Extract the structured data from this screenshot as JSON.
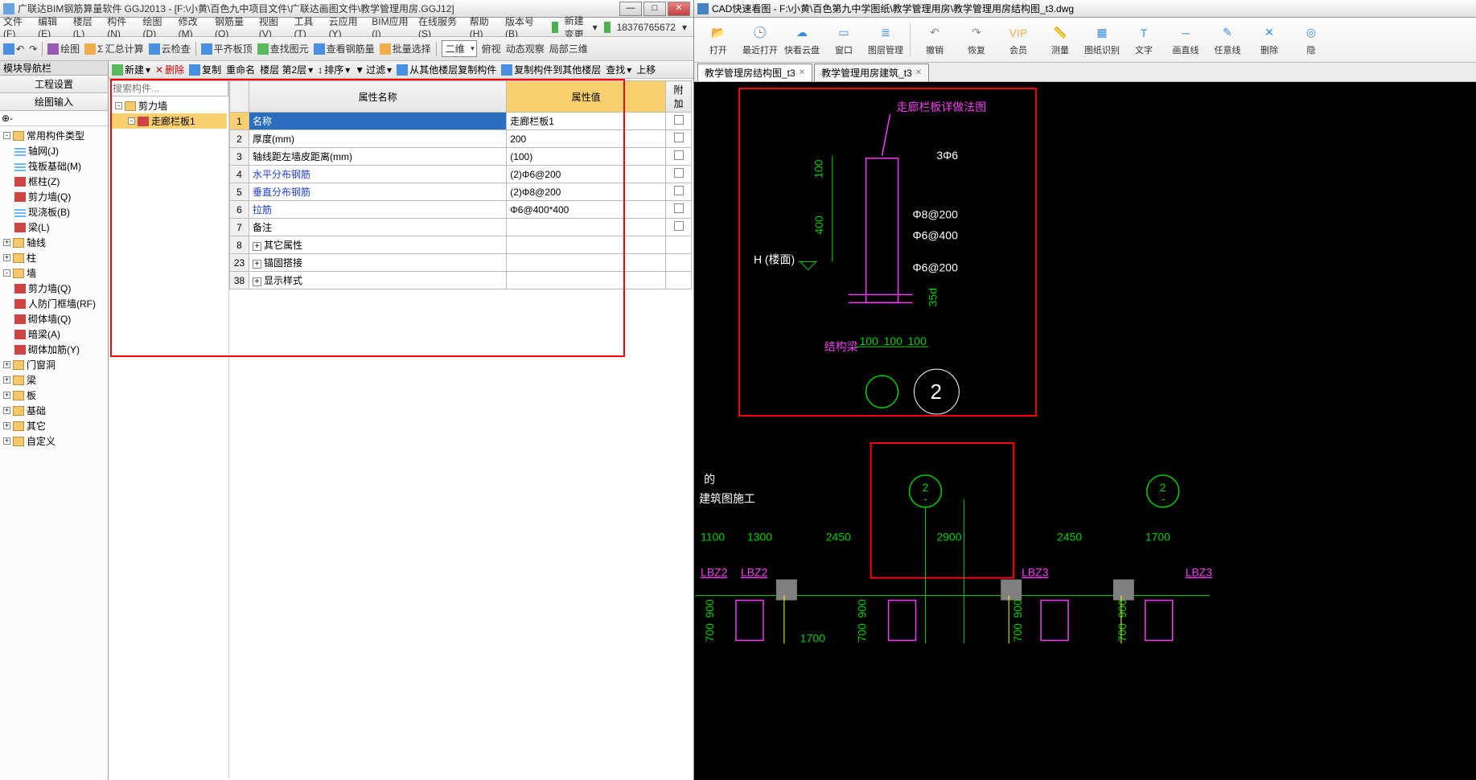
{
  "left": {
    "title": "广联达BIM钢筋算量软件 GGJ2013 - [F:\\小黄\\百色九中项目文件\\广联达画图文件\\教学管理用房.GGJ12]",
    "menu": [
      "文件(F)",
      "编辑(E)",
      "楼层(L)",
      "构件(N)",
      "绘图(D)",
      "修改(M)",
      "钢筋量(Q)",
      "视图(V)",
      "工具(T)",
      "云应用(Y)",
      "BIM应用(I)",
      "在线服务(S)",
      "帮助(H)",
      "版本号(B)"
    ],
    "menu_right": {
      "new_change": "新建变更",
      "phone": "18376765672"
    },
    "toolbar1": [
      "绘图",
      "汇总计算",
      "云检查",
      "平齐板顶",
      "查找图元",
      "查看钢筋量",
      "批量选择"
    ],
    "toolbar1_right": {
      "mode": "二维",
      "items": [
        "俯视",
        "动态观察",
        "局部三维"
      ]
    },
    "nav": {
      "title": "模块导航栏",
      "tabs": [
        "工程设置",
        "绘图输入"
      ]
    },
    "tree": [
      {
        "lvl": 0,
        "exp": "-",
        "ico": "folder",
        "label": "常用构件类型"
      },
      {
        "lvl": 1,
        "ico": "grid",
        "label": "轴网(J)"
      },
      {
        "lvl": 1,
        "ico": "grid",
        "label": "筏板基础(M)"
      },
      {
        "lvl": 1,
        "ico": "bar",
        "label": "框柱(Z)"
      },
      {
        "lvl": 1,
        "ico": "bar",
        "label": "剪力墙(Q)"
      },
      {
        "lvl": 1,
        "ico": "grid",
        "label": "现浇板(B)"
      },
      {
        "lvl": 1,
        "ico": "bar",
        "label": "梁(L)"
      },
      {
        "lvl": 0,
        "exp": "+",
        "ico": "folder",
        "label": "轴线"
      },
      {
        "lvl": 0,
        "exp": "+",
        "ico": "folder",
        "label": "柱"
      },
      {
        "lvl": 0,
        "exp": "-",
        "ico": "folder",
        "label": "墙"
      },
      {
        "lvl": 1,
        "ico": "bar",
        "label": "剪力墙(Q)"
      },
      {
        "lvl": 1,
        "ico": "bar",
        "label": "人防门框墙(RF)"
      },
      {
        "lvl": 1,
        "ico": "bar",
        "label": "砌体墙(Q)"
      },
      {
        "lvl": 1,
        "ico": "bar",
        "label": "暗梁(A)"
      },
      {
        "lvl": 1,
        "ico": "bar",
        "label": "砌体加筋(Y)"
      },
      {
        "lvl": 0,
        "exp": "+",
        "ico": "folder",
        "label": "门窗洞"
      },
      {
        "lvl": 0,
        "exp": "+",
        "ico": "folder",
        "label": "梁"
      },
      {
        "lvl": 0,
        "exp": "+",
        "ico": "folder",
        "label": "板"
      },
      {
        "lvl": 0,
        "exp": "+",
        "ico": "folder",
        "label": "基础"
      },
      {
        "lvl": 0,
        "exp": "+",
        "ico": "folder",
        "label": "其它"
      },
      {
        "lvl": 0,
        "exp": "+",
        "ico": "folder",
        "label": "自定义"
      }
    ],
    "center_tb": [
      "新建",
      "删除",
      "复制",
      "重命名",
      "楼层 第2层",
      "排序",
      "过滤",
      "从其他楼层复制构件",
      "复制构件到其他楼层",
      "查找",
      "上移"
    ],
    "comp_search_placeholder": "搜索构件...",
    "comp_tree": [
      {
        "label": "剪力墙",
        "sel": false,
        "lvl": 0
      },
      {
        "label": "走廊栏板1",
        "sel": true,
        "lvl": 1
      }
    ],
    "prop_headers": {
      "num": "",
      "name": "属性名称",
      "value": "属性值",
      "extra": "附加"
    },
    "prop_rows": [
      {
        "n": "1",
        "name": "名称",
        "value": "走廊栏板1",
        "sel": true
      },
      {
        "n": "2",
        "name": "厚度(mm)",
        "value": "200"
      },
      {
        "n": "3",
        "name": "轴线距左墙皮距离(mm)",
        "value": "(100)"
      },
      {
        "n": "4",
        "name": "水平分布钢筋",
        "value": "(2)Φ6@200",
        "link": true
      },
      {
        "n": "5",
        "name": "垂直分布钢筋",
        "value": "(2)Φ8@200",
        "link": true
      },
      {
        "n": "6",
        "name": "拉筋",
        "value": "Φ6@400*400",
        "link": true
      },
      {
        "n": "7",
        "name": "备注",
        "value": ""
      },
      {
        "n": "8",
        "name": "其它属性",
        "value": "",
        "grp": true
      },
      {
        "n": "23",
        "name": "锚固搭接",
        "value": "",
        "grp": true
      },
      {
        "n": "38",
        "name": "显示样式",
        "value": "",
        "grp": true
      }
    ]
  },
  "right": {
    "title": "CAD快速看图 - F:\\小黄\\百色第九中学图纸\\教学管理用房\\教学管理用房结构图_t3.dwg",
    "ribbon": [
      {
        "icon": "📂",
        "color": "blue",
        "label": "打开"
      },
      {
        "icon": "🕒",
        "color": "blue",
        "label": "最近打开"
      },
      {
        "icon": "☁",
        "color": "blue",
        "label": "快看云盘"
      },
      {
        "icon": "▭",
        "color": "blue",
        "label": "窗口"
      },
      {
        "icon": "≣",
        "color": "blue",
        "label": "图层管理"
      },
      {
        "sep": true
      },
      {
        "icon": "↶",
        "color": "gray",
        "label": "撤销"
      },
      {
        "icon": "↷",
        "color": "gray",
        "label": "恢复"
      },
      {
        "icon": "VIP",
        "color": "orange",
        "label": "会员"
      },
      {
        "icon": "📏",
        "color": "blue",
        "label": "测量"
      },
      {
        "icon": "▦",
        "color": "blue",
        "label": "图纸识别"
      },
      {
        "icon": "T",
        "color": "blue",
        "label": "文字"
      },
      {
        "icon": "─",
        "color": "blue",
        "label": "画直线"
      },
      {
        "icon": "✎",
        "color": "blue",
        "label": "任意线"
      },
      {
        "icon": "✕",
        "color": "blue",
        "label": "删除"
      },
      {
        "icon": "◎",
        "color": "blue",
        "label": "隐"
      }
    ],
    "tabs": [
      {
        "label": "教学管理房结构图_t3",
        "active": true
      },
      {
        "label": "教学管理用房建筑_t3",
        "active": false
      }
    ],
    "cad": {
      "detail_title": "走廊栏板详做法图",
      "h_label": "H (楼面)",
      "beam_label": "结构梁",
      "rebar_labels": [
        "3Φ6",
        "Φ8@200",
        "Φ6@400",
        "Φ6@200"
      ],
      "dims": [
        "100",
        "400",
        "35d",
        "100",
        "100",
        "100"
      ],
      "circle_num": "2",
      "bottom_text": "的\n建筑图施工",
      "grid_dims": [
        "1100",
        "1300",
        "2450",
        "2900",
        "2450",
        "1700"
      ],
      "grid_labels": [
        "LBZ2",
        "LBZ2",
        "LBZ3",
        "LBZ3"
      ],
      "v_dims": [
        "900",
        "700",
        "900",
        "700",
        "900",
        "700",
        "900",
        "700",
        "1700"
      ]
    }
  }
}
